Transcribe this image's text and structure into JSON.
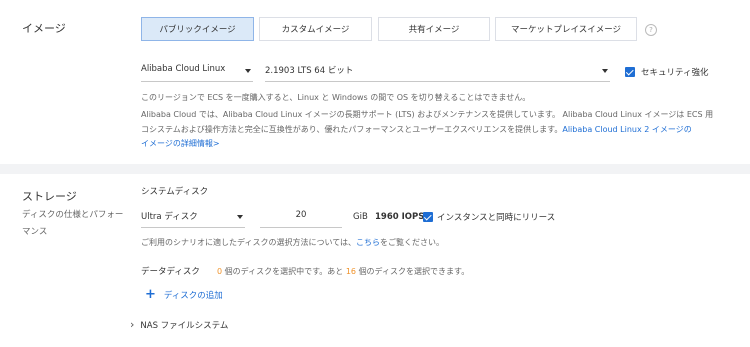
{
  "image": {
    "section_title": "イメージ",
    "tabs": [
      {
        "label": "パブリックイメージ",
        "active": true
      },
      {
        "label": "カスタムイメージ",
        "active": false
      },
      {
        "label": "共有イメージ",
        "active": false
      },
      {
        "label": "マーケットプレイスイメージ",
        "active": false
      }
    ],
    "help_glyph": "?",
    "os_select": "Alibaba Cloud Linux",
    "version_select": "2.1903 LTS 64 ビット",
    "security_checkbox": {
      "label": "セキュリティ強化",
      "checked": true
    },
    "note1": "このリージョンで ECS を一度購入すると、Linux と Windows の間で OS を切り替えることはできません。",
    "note2_line1": "Alibaba Cloud では、Alibaba Cloud Linux イメージの長期サポート (LTS) およびメンテナンスを提供しています。 Alibaba Cloud Linux イメージは ECS 用",
    "note2_line2_text": "コシステムおよび操作方法と完全に互換性があり、優れたパフォーマンスとユーザーエクスペリエンスを提供します。",
    "note2_line2_link": "Alibaba Cloud Linux 2 イメージの",
    "note2_line3_link": "イメージの詳細情報>"
  },
  "storage": {
    "section_title": "ストレージ",
    "section_desc": "ディスクの仕様とパフォーマンス",
    "system_disk": {
      "label": "システムディスク",
      "type": "Ultra ディスク",
      "size": "20",
      "unit": "GiB",
      "iops": "1960 IOPS",
      "release_checkbox": {
        "label": "インスタンスと同時にリリース",
        "checked": true
      }
    },
    "scenario_note_prefix": "ご利用のシナリオに適したディスクの選択方法については、",
    "scenario_note_link": "こちら",
    "scenario_note_suffix": "をご覧ください。",
    "data_disk": {
      "label": "データディスク",
      "selected_count": "0",
      "text_a": "個のディスクを選択中です。あと",
      "remaining_count": "16",
      "text_b": "個のディスクを選択できます。",
      "add_icon": "+",
      "add_label": "ディスクの追加"
    },
    "nas": {
      "chevron": "›",
      "label": "NAS ファイルシステム"
    }
  },
  "colors": {
    "accent": "#1f6ed4",
    "highlight": "#f0932b",
    "tab_active_bg": "#dbe9f8"
  }
}
